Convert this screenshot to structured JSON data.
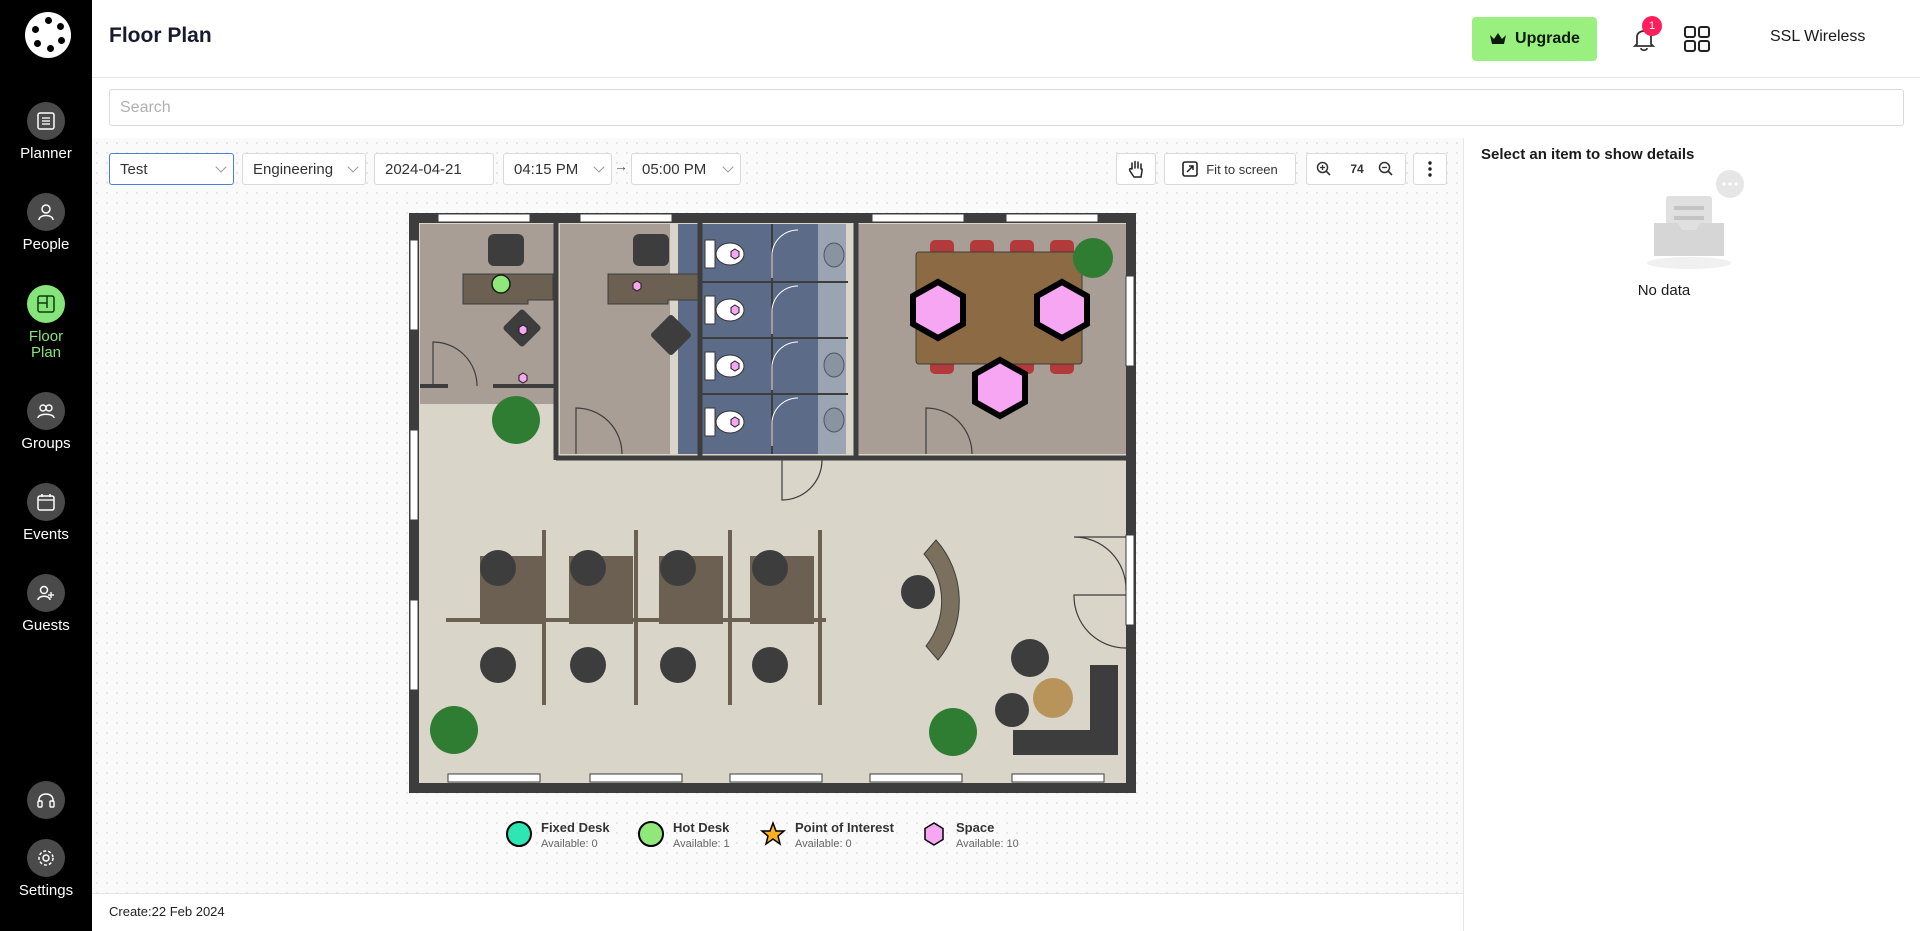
{
  "sidebar": {
    "items": [
      {
        "label": "Planner",
        "icon": "planner-icon",
        "active": false
      },
      {
        "label": "People",
        "icon": "person-icon",
        "active": false
      },
      {
        "label": "Floor Plan",
        "icon": "floorplan-icon",
        "active": true
      },
      {
        "label": "Groups",
        "icon": "groups-icon",
        "active": false
      },
      {
        "label": "Events",
        "icon": "calendar-icon",
        "active": false
      },
      {
        "label": "Guests",
        "icon": "guests-icon",
        "active": false
      }
    ],
    "settings_label": "Settings",
    "accent_color": "#86e57a"
  },
  "header": {
    "title": "Floor Plan",
    "upgrade_label": "Upgrade",
    "notification_count": "1",
    "user_name": "SSL Wireless"
  },
  "search": {
    "placeholder": "Search"
  },
  "toolbar": {
    "floor": "Test",
    "department": "Engineering",
    "date": "2024-04-21",
    "time_from": "04:15 PM",
    "arrow": "→",
    "time_to": "05:00 PM",
    "fit_label": "Fit to screen",
    "zoom": "74"
  },
  "details": {
    "title": "Select an item to show details",
    "empty_text": "No data"
  },
  "legend": [
    {
      "name": "Fixed Desk",
      "available": "Available: 0",
      "color": "#2ee6b4"
    },
    {
      "name": "Hot Desk",
      "available": "Available: 1",
      "color": "#8fe879"
    },
    {
      "name": "Point of Interest",
      "available": "Available: 0",
      "color": "#ffb020"
    },
    {
      "name": "Space",
      "available": "Available: 10",
      "color": "#f7a6f4"
    }
  ],
  "footer": {
    "prefix": "Create:",
    "date": "22 Feb 2024"
  }
}
